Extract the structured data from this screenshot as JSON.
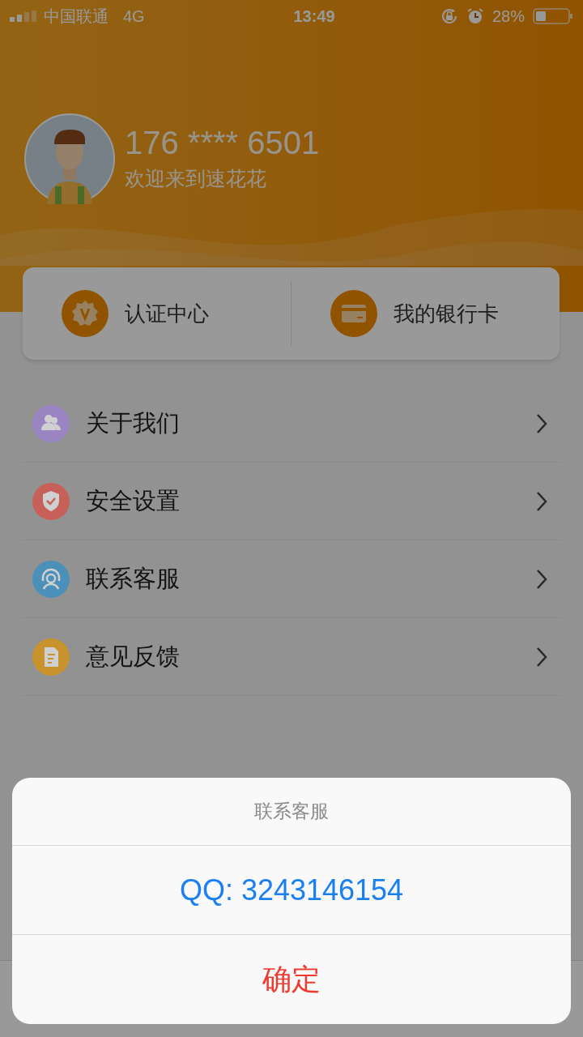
{
  "status_bar": {
    "carrier": "中国联通",
    "network": "4G",
    "time": "13:49",
    "battery": "28%"
  },
  "profile": {
    "phone": "176 **** 6501",
    "welcome": "欢迎来到速花花"
  },
  "quick_actions": [
    {
      "kind": "badge",
      "label": "认证中心"
    },
    {
      "kind": "card",
      "label": "我的银行卡"
    }
  ],
  "menu": [
    {
      "kind": "people",
      "label": "关于我们",
      "color": "#9a84c2"
    },
    {
      "kind": "shield",
      "label": "安全设置",
      "color": "#c8605a"
    },
    {
      "kind": "headset",
      "label": "联系客服",
      "color": "#4a90b8"
    },
    {
      "kind": "doc",
      "label": "意见反馈",
      "color": "#c8922c"
    }
  ],
  "action_sheet": {
    "title": "联系客服",
    "option": "QQ: 3243146154",
    "confirm": "确定"
  }
}
